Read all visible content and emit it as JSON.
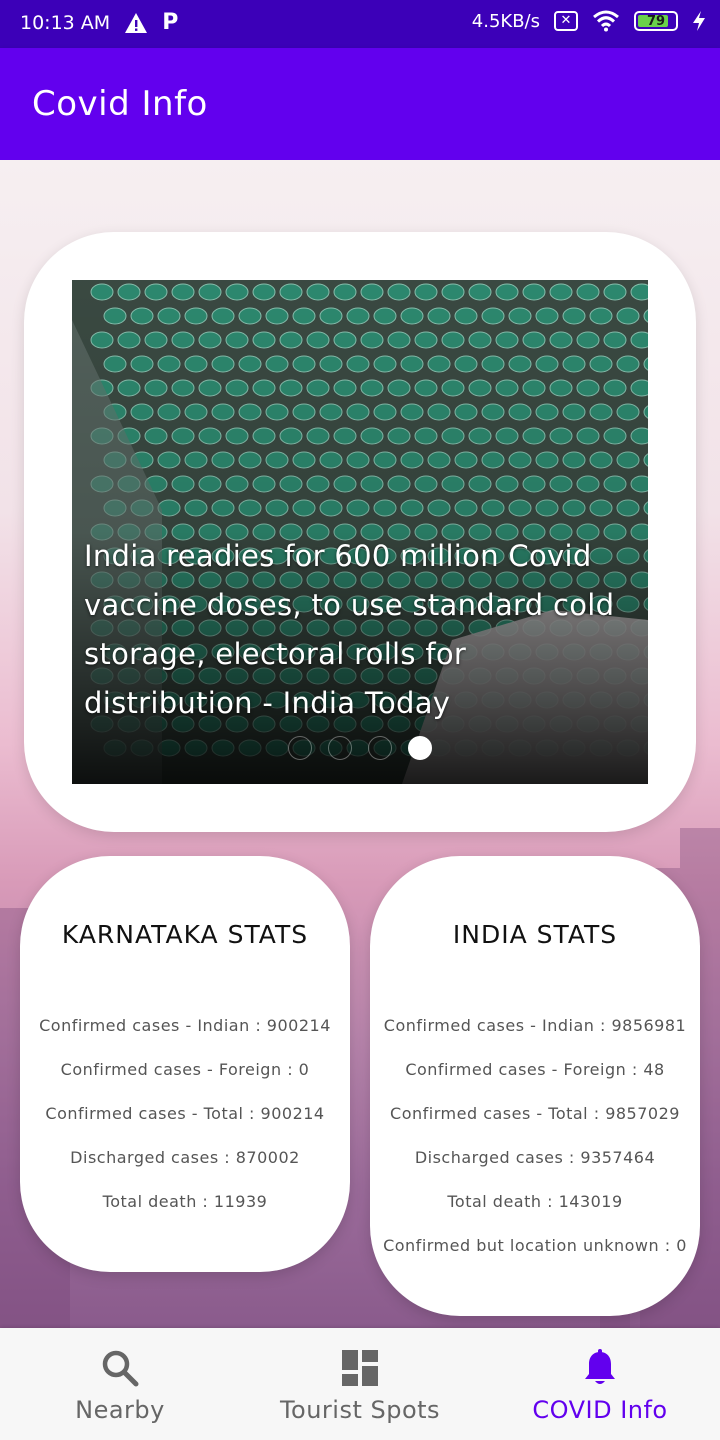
{
  "status_bar": {
    "time": "10:13 AM",
    "speed": "4.5KB/s",
    "battery": "79",
    "icons": [
      "warning-icon",
      "p-icon",
      "sim-x-icon",
      "wifi-icon",
      "battery-icon",
      "charging-icon"
    ]
  },
  "app_bar": {
    "title": "Covid Info"
  },
  "carousel": {
    "headline": "India readies for 600 million Covid vaccine doses, to use standard cold storage, electoral rolls for distribution - India Today",
    "dot_count": 4,
    "active_index": 3
  },
  "karnataka": {
    "title": "KARNATAKA STATS",
    "lines": [
      "Confirmed cases - Indian : 900214",
      "Confirmed cases - Foreign : 0",
      "Confirmed cases - Total : 900214",
      "Discharged cases : 870002",
      "Total death : 11939"
    ]
  },
  "india": {
    "title": "INDIA STATS",
    "lines": [
      "Confirmed cases - Indian : 9856981",
      "Confirmed cases - Foreign : 48",
      "Confirmed cases - Total : 9857029",
      "Discharged cases : 9357464",
      "Total death : 143019",
      "Confirmed but location unknown : 0"
    ]
  },
  "bottom_nav": {
    "items": [
      {
        "label": "Nearby",
        "icon": "search-icon"
      },
      {
        "label": "Tourist Spots",
        "icon": "dashboard-icon"
      },
      {
        "label": "COVID Info",
        "icon": "bell-icon"
      }
    ],
    "active_index": 2
  },
  "colors": {
    "status_bar": "#3c00b8",
    "primary": "#6200ee",
    "battery_fill": "#6ad14a"
  }
}
